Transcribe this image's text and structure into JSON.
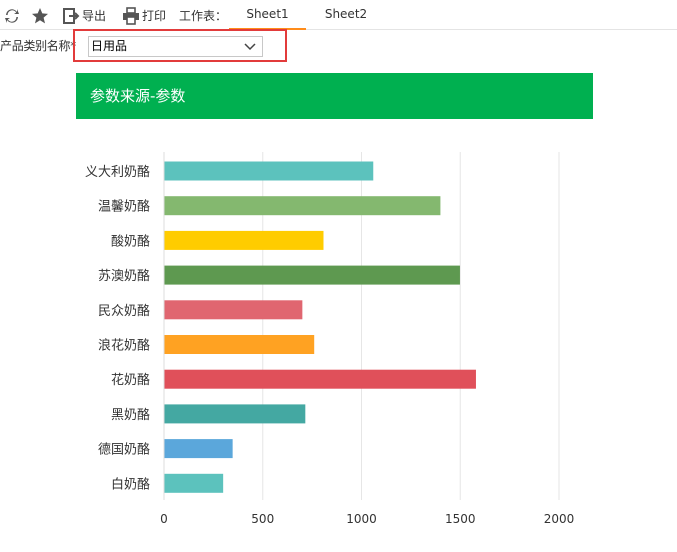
{
  "toolbar": {
    "refresh_icon": "refresh-icon",
    "favorite_icon": "star-icon",
    "export_label": "导出",
    "print_label": "打印",
    "sheets_label": "工作表：",
    "tabs": [
      {
        "label": "Sheet1",
        "active": true
      },
      {
        "label": "Sheet2",
        "active": false
      }
    ]
  },
  "params": {
    "label": "产品类别名称*",
    "value": "日用品"
  },
  "report": {
    "title": "参数来源-参数"
  },
  "colors": {
    "accent_green": "#00b050",
    "active_tab": "#ff8c1a",
    "highlight_border": "#e23b3b"
  },
  "chart_data": {
    "type": "bar",
    "orientation": "horizontal",
    "categories": [
      "义大利奶酪",
      "温馨奶酪",
      "酸奶酪",
      "苏澳奶酪",
      "民众奶酪",
      "浪花奶酪",
      "花奶酪",
      "黑奶酪",
      "德国奶酪",
      "白奶酪"
    ],
    "values": [
      1057,
      1397,
      805,
      1496,
      698,
      758,
      1577,
      713,
      345,
      297
    ],
    "colors": [
      "#5cc2bd",
      "#84b86f",
      "#ffcc00",
      "#5e9950",
      "#e06670",
      "#ffa222",
      "#e0505a",
      "#44a8a2",
      "#5ba7db",
      "#5cc2bd"
    ],
    "xlim": [
      0,
      2000
    ],
    "xticks": [
      0,
      500,
      1000,
      1500,
      2000
    ],
    "grid": true,
    "title": "",
    "xlabel": "",
    "ylabel": ""
  }
}
